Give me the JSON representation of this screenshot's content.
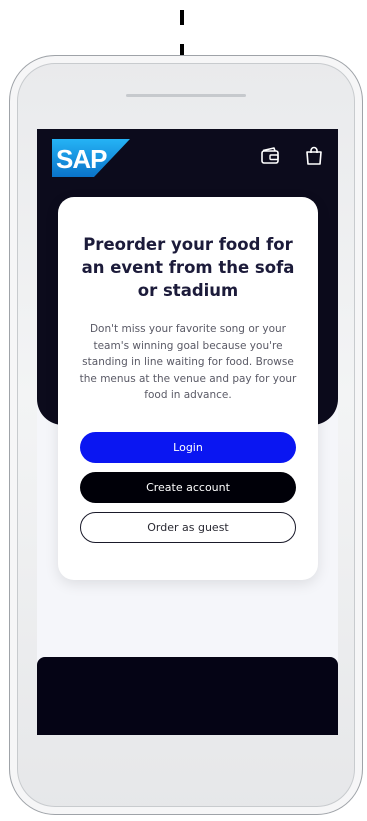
{
  "header": {
    "logo_text": "SAP",
    "icons": [
      "wallet-icon",
      "shopping-bag-icon"
    ]
  },
  "card": {
    "title": "Preorder your food for an event from the sofa or stadium",
    "description": "Don't miss your favorite song or your team's winning goal because you're standing in line waiting for food. Browse the menus at the venue and pay for your food in advance."
  },
  "buttons": {
    "login": "Login",
    "create_account": "Create account",
    "order_as_guest": "Order as guest"
  },
  "colors": {
    "hero_background": "#0c0b1c",
    "login_button": "#0a16f2",
    "create_button": "#000008",
    "sap_blue": "#1aa0e8"
  }
}
